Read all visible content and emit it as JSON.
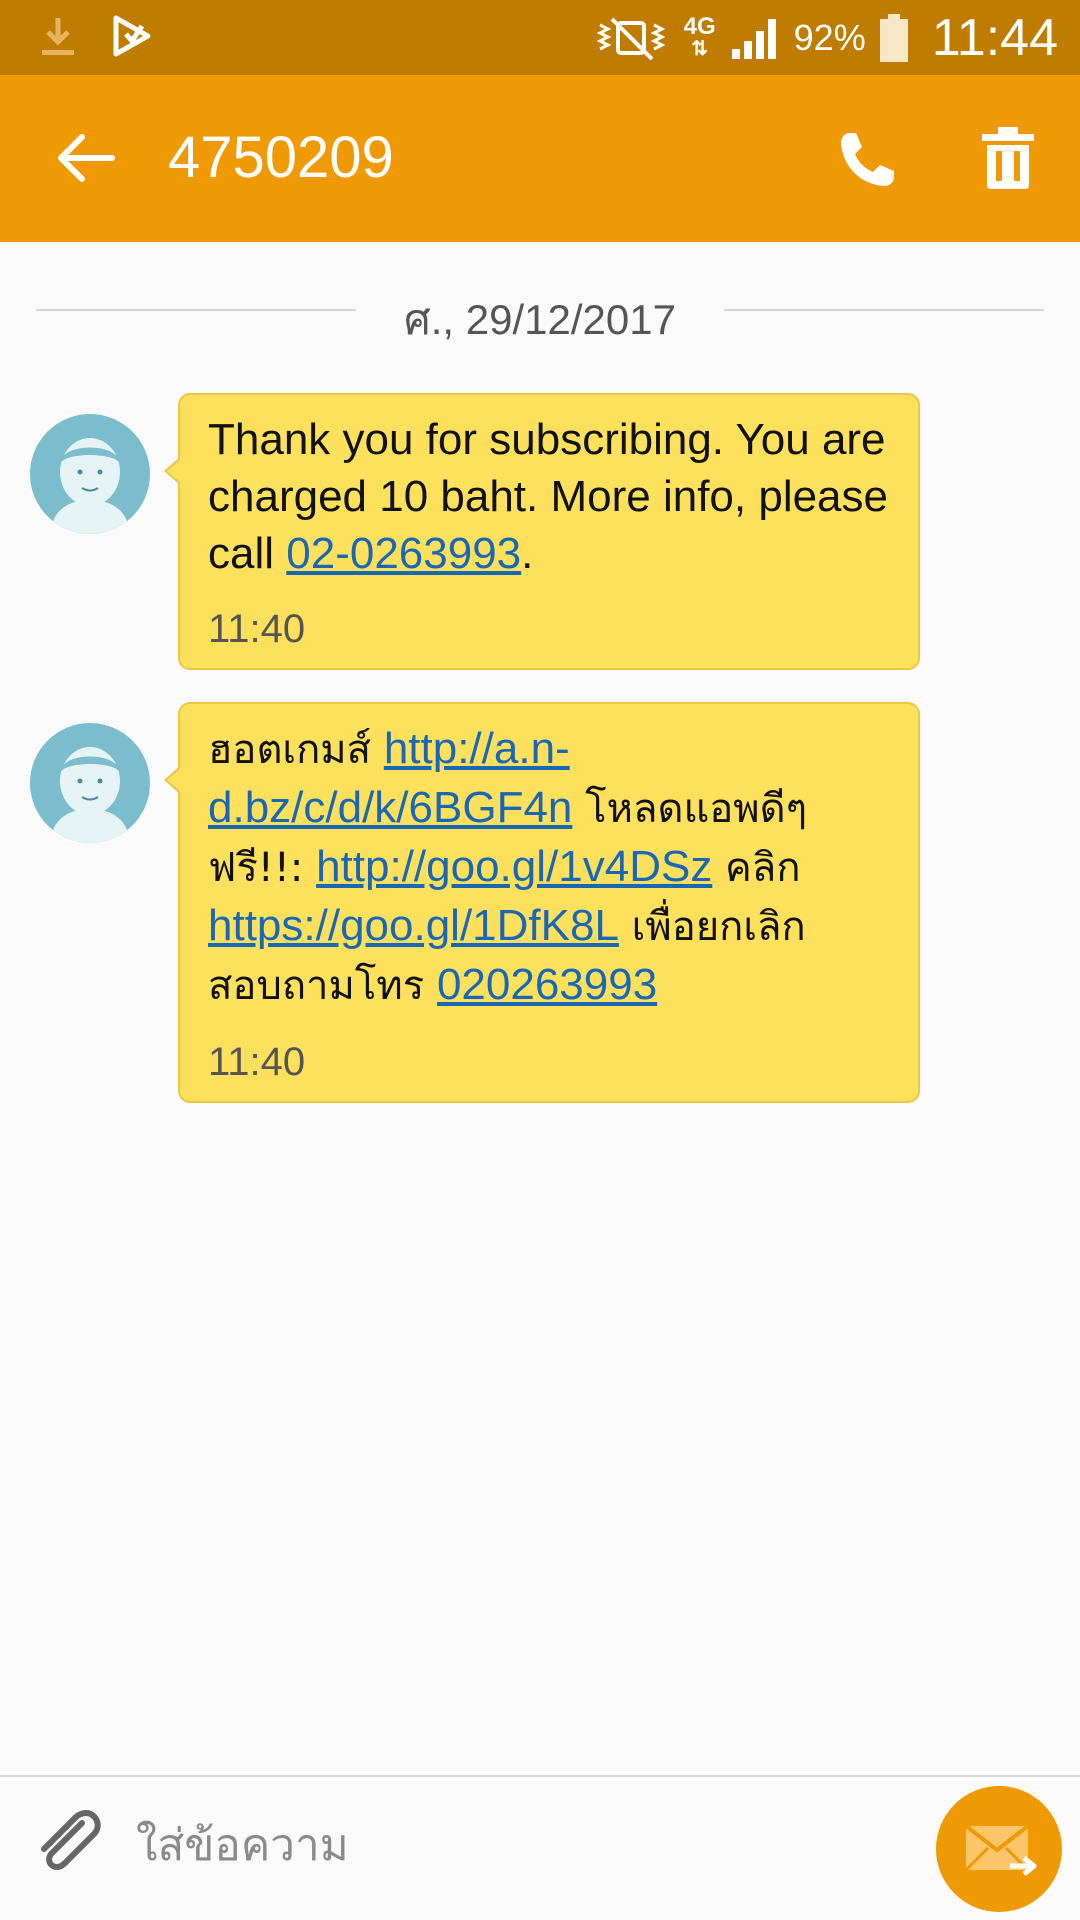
{
  "status_bar": {
    "network": "4G",
    "battery": "92%",
    "time": "11:44"
  },
  "header": {
    "title": "4750209"
  },
  "date_separator": "ศ., 29/12/2017",
  "messages": [
    {
      "parts": [
        {
          "text": "Thank you for subscribing. You are charged 10 baht. More info, please call ",
          "link": false
        },
        {
          "text": "02-0263993",
          "link": true
        },
        {
          "text": ".",
          "link": false
        }
      ],
      "time": "11:40"
    },
    {
      "parts": [
        {
          "text": "ฮอตเกมส์ ",
          "link": false
        },
        {
          "text": "http://a.n-d.bz/c/d/k/6BGF4n",
          "link": true
        },
        {
          "text": "  โหลดแอพดีๆฟรี!!: ",
          "link": false
        },
        {
          "text": "http://goo.gl/1v4DSz",
          "link": true
        },
        {
          "text": " คลิก ",
          "link": false
        },
        {
          "text": "https://goo.gl/1DfK8L",
          "link": true
        },
        {
          "text": "   เพื่อยกเลิก สอบถามโทร ",
          "link": false
        },
        {
          "text": "020263993",
          "link": true
        }
      ],
      "time": "11:40"
    }
  ],
  "composer": {
    "placeholder": "ใส่ข้อความ"
  },
  "icons": [
    "download-icon",
    "play-store-icon",
    "mute-icon",
    "signal-icon",
    "battery-icon",
    "back-arrow-icon",
    "phone-icon",
    "trash-icon",
    "avatar-icon",
    "paperclip-icon",
    "send-icon"
  ],
  "colors": {
    "status_bar": "#c07c00",
    "app_bar": "#ef9a05",
    "bubble": "#fde15d",
    "link": "#1a67b5",
    "avatar": "#7bbdcc"
  }
}
